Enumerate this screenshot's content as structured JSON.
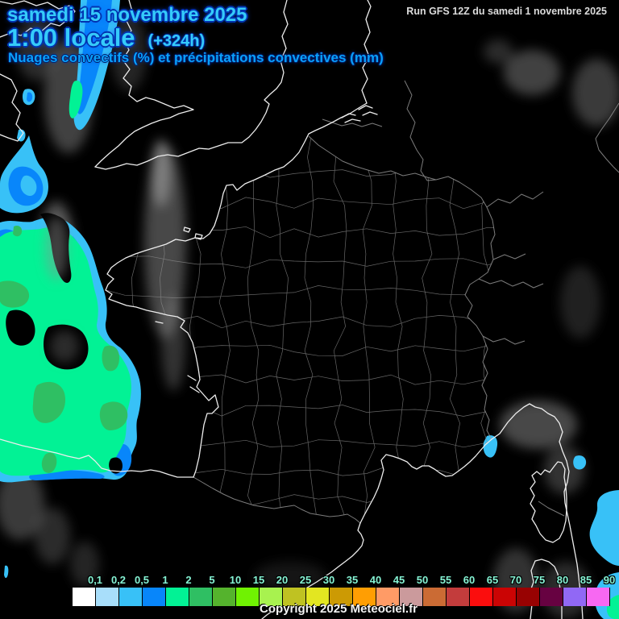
{
  "header": {
    "date": "samedi 15 novembre 2025",
    "time": "1:00 locale",
    "offset": "(+324h)",
    "subtitle": "Nuages convectifs (%) et précipitations convectives (mm)",
    "text_color": "#35cbfa",
    "subtitle_color": "#09a1fc"
  },
  "run_box": {
    "text": "Run GFS 12Z du samedi 1 novembre 2025"
  },
  "footer": {
    "copyright": "Copyright 2025 Meteociel.fr"
  },
  "legend": {
    "label_color": "#85f2d3",
    "items": [
      {
        "label": "0,1",
        "color": "#ffffff"
      },
      {
        "label": "0,2",
        "color": "#a8defa"
      },
      {
        "label": "0,5",
        "color": "#38c1f7"
      },
      {
        "label": "1",
        "color": "#0886fa"
      },
      {
        "label": "2",
        "color": "#02f295"
      },
      {
        "label": "5",
        "color": "#2fbf63"
      },
      {
        "label": "10",
        "color": "#55b32d"
      },
      {
        "label": "15",
        "color": "#70f202"
      },
      {
        "label": "20",
        "color": "#a8f24f"
      },
      {
        "label": "25",
        "color": "#bfc222"
      },
      {
        "label": "30",
        "color": "#e3e621"
      },
      {
        "label": "35",
        "color": "#cc9a04"
      },
      {
        "label": "40",
        "color": "#ff9e03"
      },
      {
        "label": "45",
        "color": "#ff9b66"
      },
      {
        "label": "50",
        "color": "#cb9a9c"
      },
      {
        "label": "55",
        "color": "#cb6b34"
      },
      {
        "label": "60",
        "color": "#c33c3c"
      },
      {
        "label": "65",
        "color": "#fb0d0d"
      },
      {
        "label": "70",
        "color": "#cb0404"
      },
      {
        "label": "75",
        "color": "#980202"
      },
      {
        "label": "80",
        "color": "#670241"
      },
      {
        "label": "85",
        "color": "#9168f5"
      },
      {
        "label": "90",
        "color": "#f768f2"
      }
    ]
  },
  "map": {
    "background": "#000000",
    "coast_color": "#ededed",
    "border_color": "#9b9b9b",
    "department_color": "#8f8f8f",
    "cloud_color": "#909090",
    "precip_colors": {
      "light": "#38c1f7",
      "moderate": "#0886fa",
      "heavy": "#02f295",
      "intense": "#2fbf63"
    }
  }
}
